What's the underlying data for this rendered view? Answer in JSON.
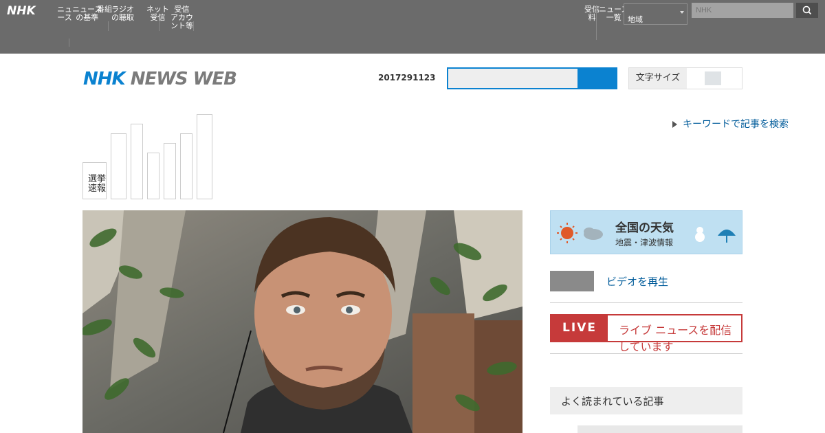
{
  "topbar": {
    "logo": "NHK",
    "nav": [
      "ニュ\nース",
      "ニュース\nの基準",
      "番組",
      "ラジオ\nの聴取",
      "ネット\n受信",
      "受信\nアカウ\nント等"
    ],
    "right_nav": [
      "受信\n料",
      "ニュース\n一覧"
    ],
    "select_value": "地域",
    "search_placeholder": "NHK"
  },
  "header": {
    "brand_a": "NHK",
    "brand_b": "NEWS WEB",
    "date": "2017291123",
    "mode_label": "文字サイズ"
  },
  "topic_link": "キーワードで記事を検索",
  "bar_label": "選挙\n速報",
  "weather": {
    "title": "全国の天気",
    "subtitle": "地震・津波情報"
  },
  "grey_link": "ビデオを再生",
  "live": {
    "tag": "LIVE",
    "text": "ライブ ニュースを配信しています"
  },
  "popular_title": "よく読まれている記事"
}
